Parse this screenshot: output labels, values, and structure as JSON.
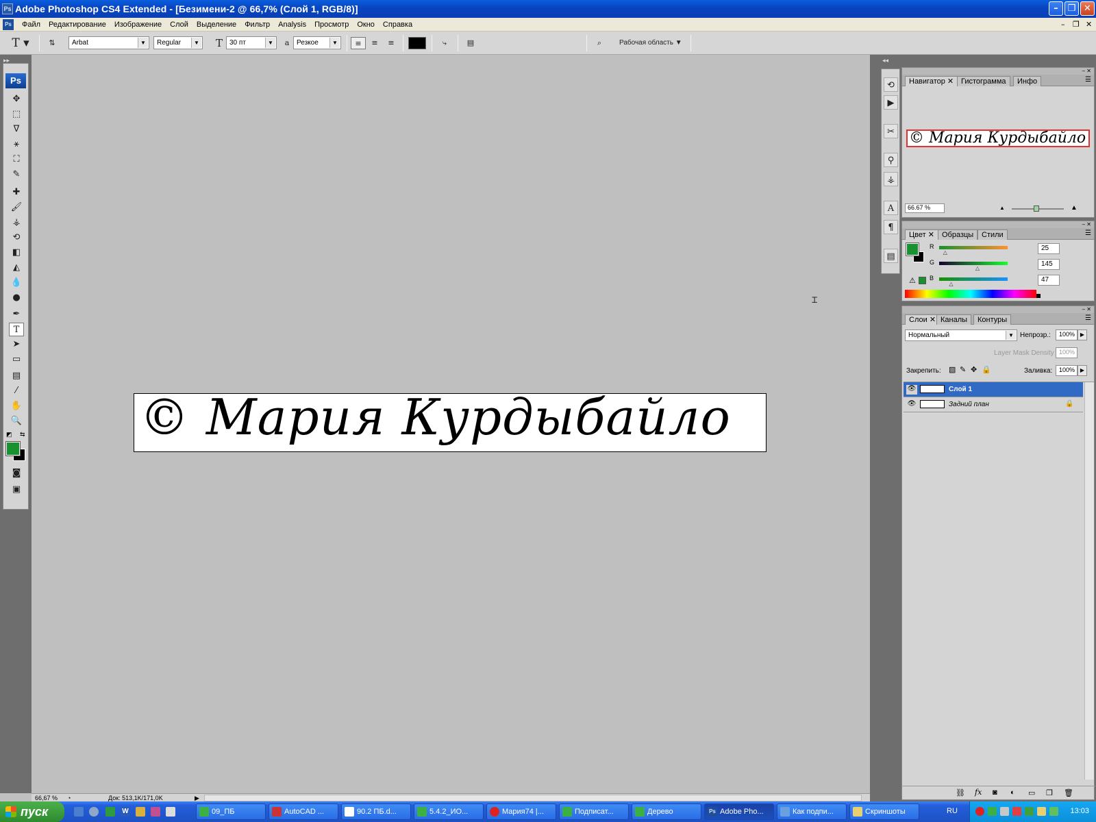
{
  "window": {
    "title": "Adobe Photoshop CS4 Extended - [Безимени-2 @ 66,7% (Слой 1, RGB/8)]",
    "app_icon": "Ps"
  },
  "menu": {
    "items": [
      "Файл",
      "Редактирование",
      "Изображение",
      "Слой",
      "Выделение",
      "Фильтр",
      "Analysis",
      "Просмотр",
      "Окно",
      "Справка"
    ]
  },
  "options": {
    "tool_glyph": "T",
    "font_family": "Arbat",
    "font_style": "Regular",
    "font_size": "30 пт",
    "aa_label": "a",
    "antialias": "Резкое",
    "workspace": "Рабочая область"
  },
  "toolbox": {
    "logo": "Ps"
  },
  "document": {
    "text": "© Мария Курдыбайло"
  },
  "status": {
    "zoom": "66,67 %",
    "doc_info": "Док: 513,1K/171,0K"
  },
  "navigator": {
    "tabs": [
      "Навигатор",
      "Гистограмма",
      "Инфо"
    ],
    "preview_text": "© Мария Курдыбайло",
    "zoom": "66.67 %"
  },
  "color_panel": {
    "tabs": [
      "Цвет",
      "Образцы",
      "Стили"
    ],
    "channels": [
      {
        "label": "R",
        "value": "25",
        "level": 0.098
      },
      {
        "label": "G",
        "value": "145",
        "level": 0.569
      },
      {
        "label": "B",
        "value": "47",
        "level": 0.184
      }
    ],
    "foreground": "#19912f",
    "background": "#000000"
  },
  "layers_panel": {
    "tabs": [
      "Слои",
      "Каналы",
      "Контуры"
    ],
    "blend_mode": "Нормальный",
    "opacity_label": "Непрозр.:",
    "opacity": "100%",
    "mask_density_label": "Layer Mask Density",
    "mask_density": "100%",
    "lock_label": "Закрепить:",
    "fill_label": "Заливка:",
    "fill": "100%",
    "layers": [
      {
        "name": "Слой 1",
        "selected": true
      },
      {
        "name": "Задний план",
        "selected": false
      }
    ]
  },
  "taskbar": {
    "start": "пуск",
    "tasks": [
      "09_ПБ",
      "AutoCAD ...",
      "90.2 ПБ.d...",
      "5.4.2_ИО...",
      "Мария74 |...",
      "Подписат...",
      "Дерево",
      "Adobe Pho...",
      "Как подпи...",
      "Скриншоты"
    ],
    "active_task": "Adobe Pho...",
    "lang": "RU",
    "time": "13:03"
  },
  "colors": {
    "accent": "#316ac5",
    "selection_green": "#19912f"
  }
}
